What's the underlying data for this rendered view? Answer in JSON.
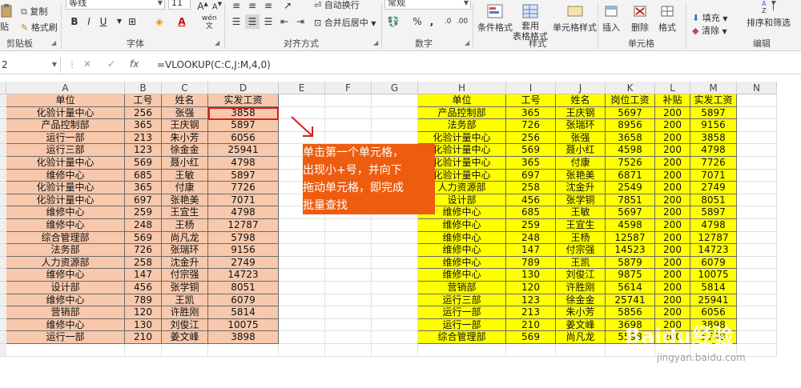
{
  "ribbon": {
    "clipboard": {
      "paste": "贴",
      "copy": "复制",
      "format_painter": "格式刷",
      "group_label": "剪贴板"
    },
    "font": {
      "font_name": "等线",
      "font_size": "11",
      "bold": "B",
      "italic": "I",
      "underline": "U",
      "wen": "wén",
      "group_label": "字体"
    },
    "alignment": {
      "wrap_text": "自动换行",
      "merge_center": "合并后居中",
      "group_label": "对齐方式"
    },
    "number": {
      "format": "常规",
      "percent": "%",
      "comma": ",",
      "group_label": "数字"
    },
    "styles": {
      "conditional": "条件格式",
      "table_format": "套用\n表格格式",
      "cell_styles": "单元格样式",
      "group_label": "样式"
    },
    "cells": {
      "insert": "插入",
      "delete": "删除",
      "format": "格式",
      "group_label": "单元格"
    },
    "editing": {
      "fill": "填充",
      "clear": "清除",
      "sort_filter": "排序和筛选",
      "group_label": "编辑"
    }
  },
  "formula_bar": {
    "name_box": "2",
    "cancel": "✕",
    "enter": "✓",
    "fx": "fx",
    "formula": "=VLOOKUP(C:C,J:M,4,0)"
  },
  "columns": [
    "A",
    "B",
    "C",
    "D",
    "E",
    "F",
    "G",
    "H",
    "I",
    "J",
    "K",
    "L",
    "M",
    "N"
  ],
  "left_table": {
    "headers": [
      "单位",
      "工号",
      "姓名",
      "实发工资"
    ],
    "rows": [
      [
        "化验计量中心",
        "256",
        "张强",
        "3858"
      ],
      [
        "产品控制部",
        "365",
        "王庆钢",
        "5897"
      ],
      [
        "运行一部",
        "213",
        "朱小芳",
        "6056"
      ],
      [
        "运行三部",
        "123",
        "徐金金",
        "25941"
      ],
      [
        "化验计量中心",
        "569",
        "聂小红",
        "4798"
      ],
      [
        "维修中心",
        "685",
        "王敏",
        "5897"
      ],
      [
        "化验计量中心",
        "365",
        "付康",
        "7726"
      ],
      [
        "化验计量中心",
        "697",
        "张艳美",
        "7071"
      ],
      [
        "维修中心",
        "259",
        "王宜生",
        "4798"
      ],
      [
        "维修中心",
        "248",
        "王杨",
        "12787"
      ],
      [
        "综合管理部",
        "569",
        "尚凡龙",
        "5798"
      ],
      [
        "法务部",
        "726",
        "张瑞环",
        "9156"
      ],
      [
        "人力资源部",
        "258",
        "沈金升",
        "2749"
      ],
      [
        "维修中心",
        "147",
        "付宗强",
        "14723"
      ],
      [
        "设计部",
        "456",
        "张学铜",
        "8051"
      ],
      [
        "维修中心",
        "789",
        "王凯",
        "6079"
      ],
      [
        "营销部",
        "120",
        "许胜刚",
        "5814"
      ],
      [
        "维修中心",
        "130",
        "刘俊江",
        "10075"
      ],
      [
        "运行一部",
        "210",
        "姜文峰",
        "3898"
      ]
    ]
  },
  "right_table": {
    "headers": [
      "单位",
      "工号",
      "姓名",
      "岗位工资",
      "补贴",
      "实发工资"
    ],
    "rows": [
      [
        "产品控制部",
        "365",
        "王庆钢",
        "5697",
        "200",
        "5897"
      ],
      [
        "法务部",
        "726",
        "张瑞环",
        "8956",
        "200",
        "9156"
      ],
      [
        "化验计量中心",
        "256",
        "张强",
        "3658",
        "200",
        "3858"
      ],
      [
        "化验计量中心",
        "569",
        "聂小红",
        "4598",
        "200",
        "4798"
      ],
      [
        "化验计量中心",
        "365",
        "付康",
        "7526",
        "200",
        "7726"
      ],
      [
        "化验计量中心",
        "697",
        "张艳美",
        "6871",
        "200",
        "7071"
      ],
      [
        "人力资源部",
        "258",
        "沈金升",
        "2549",
        "200",
        "2749"
      ],
      [
        "设计部",
        "456",
        "张学铜",
        "7851",
        "200",
        "8051"
      ],
      [
        "维修中心",
        "685",
        "王敏",
        "5697",
        "200",
        "5897"
      ],
      [
        "维修中心",
        "259",
        "王宜生",
        "4598",
        "200",
        "4798"
      ],
      [
        "维修中心",
        "248",
        "王杨",
        "12587",
        "200",
        "12787"
      ],
      [
        "维修中心",
        "147",
        "付宗强",
        "14523",
        "200",
        "14723"
      ],
      [
        "维修中心",
        "789",
        "王凯",
        "5879",
        "200",
        "6079"
      ],
      [
        "维修中心",
        "130",
        "刘俊江",
        "9875",
        "200",
        "10075"
      ],
      [
        "营销部",
        "120",
        "许胜刚",
        "5614",
        "200",
        "5814"
      ],
      [
        "运行三部",
        "123",
        "徐金金",
        "25741",
        "200",
        "25941"
      ],
      [
        "运行一部",
        "213",
        "朱小芳",
        "5856",
        "200",
        "6056"
      ],
      [
        "运行一部",
        "210",
        "姜文峰",
        "3698",
        "200",
        "3898"
      ],
      [
        "综合管理部",
        "569",
        "尚凡龙",
        "5598",
        "200",
        "5798"
      ]
    ]
  },
  "annotation": {
    "lines": [
      "单击第一个单元格，",
      "出现小+号，并向下",
      "拖动单元格，即完成",
      "批量查找"
    ]
  },
  "watermark": {
    "text": "Baidu经验",
    "url": "jingyan.baidu.com"
  },
  "colors": {
    "left_fill": "#f7c8ac",
    "right_fill": "#ffff00",
    "selection": "#e11b1b",
    "annotation": "#ee5d0f"
  }
}
